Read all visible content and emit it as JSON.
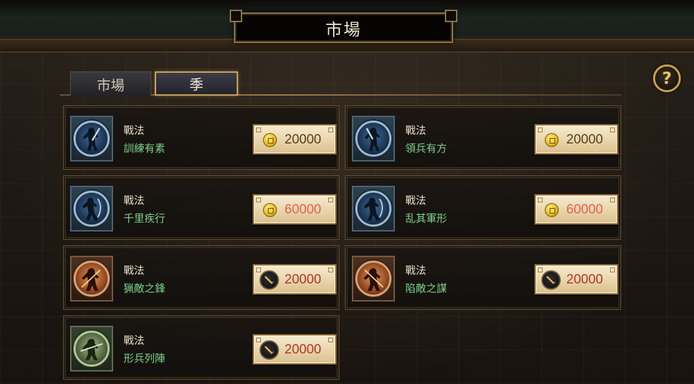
{
  "header": {
    "title": "市場"
  },
  "help": {
    "label": "?"
  },
  "tabs": [
    {
      "label": "市場",
      "active": false
    },
    {
      "label": "季",
      "active": true
    }
  ],
  "colors": {
    "gold_accent": "#c8a35c",
    "name_green": "#7fd08a",
    "price_brown": "#5a3d20",
    "price_red": "#e2624e"
  },
  "items": [
    {
      "category": "戰法",
      "name": "訓練有素",
      "price": "20000",
      "currency": "gold-coin-icon",
      "icon_style": "blue"
    },
    {
      "category": "戰法",
      "name": "領兵有方",
      "price": "20000",
      "currency": "gold-coin-icon",
      "icon_style": "blue"
    },
    {
      "category": "戰法",
      "name": "千里疾行",
      "price": "60000",
      "currency": "gold-coin-icon",
      "icon_style": "blue"
    },
    {
      "category": "戰法",
      "name": "乱其軍形",
      "price": "60000",
      "currency": "gold-coin-icon",
      "icon_style": "blue"
    },
    {
      "category": "戰法",
      "name": "猟敵之鋒",
      "price": "20000",
      "currency": "sword-token-icon",
      "icon_style": "orange"
    },
    {
      "category": "戰法",
      "name": "陷敵之謀",
      "price": "20000",
      "currency": "sword-token-icon",
      "icon_style": "orange"
    },
    {
      "category": "戰法",
      "name": "形兵列陣",
      "price": "20000",
      "currency": "sword-token-icon",
      "icon_style": "green"
    }
  ]
}
